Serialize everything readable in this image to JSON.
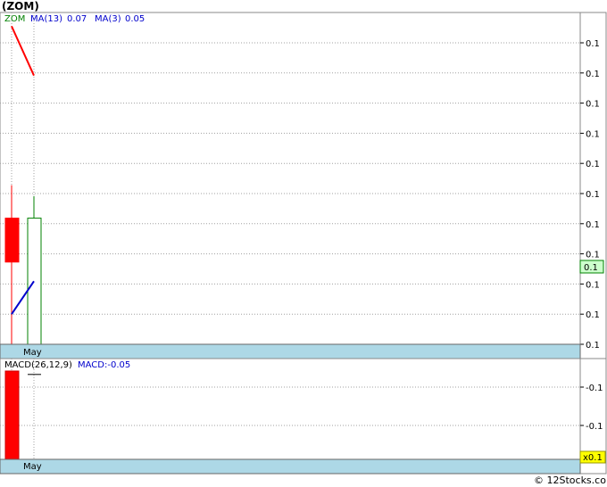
{
  "title": "(ZOM)",
  "footer": "© 12Stocks.com",
  "colors": {
    "up": "#008000",
    "down": "#ff0000",
    "ma13": "#ff0000",
    "ma3": "#0000cc",
    "axis_band": "#add8e6",
    "grid": "#a0a0a0",
    "current_price_bg": "#ccffcc",
    "current_macd_bg": "#ffff00"
  },
  "chart_data": [
    {
      "type": "candlestick",
      "legend": [
        {
          "label": "ZOM",
          "color": "#008000"
        },
        {
          "label": "MA(13)",
          "value": "0.07",
          "color": "#0000cc"
        },
        {
          "label": "MA(3)",
          "value": "0.05",
          "color": "#0000cc"
        }
      ],
      "x_tick_labels": [
        "May"
      ],
      "y_tick_labels": [
        "0.1",
        "0.1",
        "0.1",
        "0.1",
        "0.1",
        "0.1",
        "0.1",
        "0.1",
        "0.1",
        "0.1",
        "0.1"
      ],
      "current_value_label": "0.1",
      "ylim": [
        0.034,
        0.155
      ],
      "candles": [
        {
          "open": 0.08,
          "close": 0.064,
          "high": 0.092,
          "low": 0.034,
          "direction": "down"
        },
        {
          "open": 0.034,
          "close": 0.08,
          "high": 0.088,
          "low": 0.034,
          "direction": "up"
        }
      ],
      "ma13": [
        0.15,
        0.132
      ],
      "ma3": [
        0.045,
        0.057
      ]
    },
    {
      "type": "bar",
      "legend": [
        {
          "label": "MACD(26,12,9)",
          "color": "#000000"
        },
        {
          "label": "MACD:-0.05",
          "color": "#0000cc"
        }
      ],
      "x_tick_labels": [
        "May"
      ],
      "y_tick_labels": [
        "-0.1",
        "-0.1"
      ],
      "current_value_label": "x0.1",
      "ylim": [
        -0.13,
        0.0
      ],
      "values": [
        -0.13
      ],
      "signal": -0.005
    }
  ]
}
